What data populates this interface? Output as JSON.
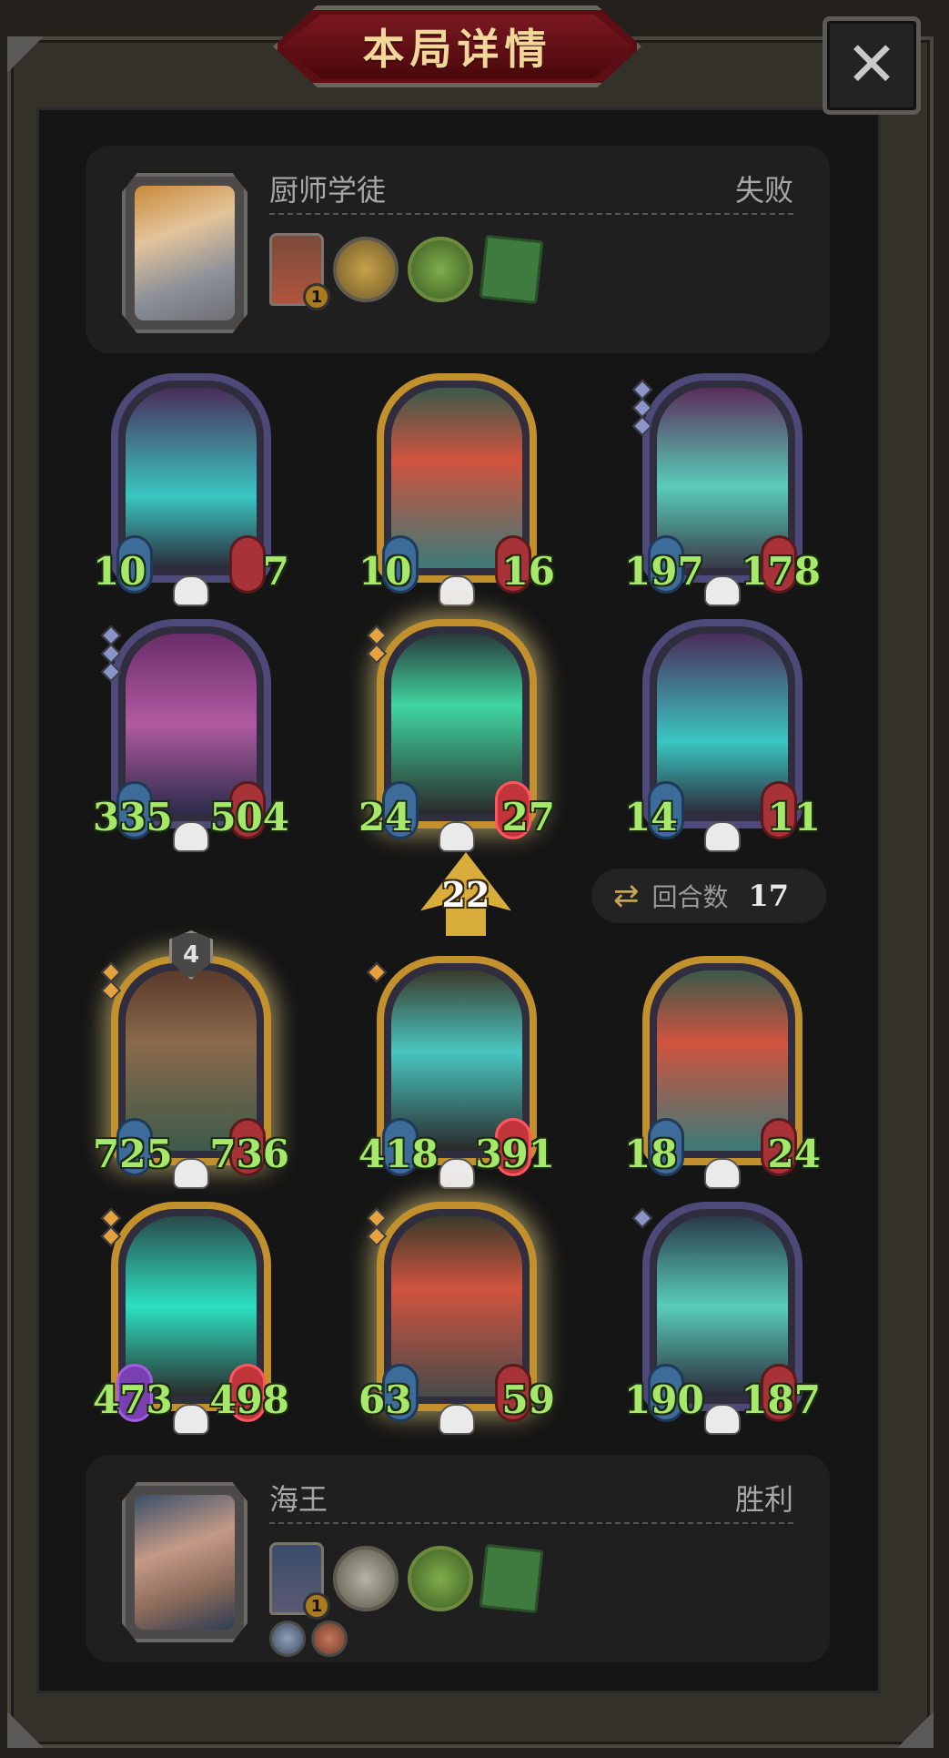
{
  "title": "本局详情",
  "close_icon": "close-icon",
  "player_top": {
    "name": "厨师学徒",
    "result": "失败",
    "hero_level": "1"
  },
  "player_bottom": {
    "name": "海王",
    "result": "胜利",
    "hero_level": "1"
  },
  "board_level": "22",
  "round": {
    "label": "回合数",
    "value": "17"
  },
  "units": [
    {
      "atk": "10",
      "hp": "7"
    },
    {
      "atk": "10",
      "hp": "16"
    },
    {
      "atk": "197",
      "hp": "178"
    },
    {
      "atk": "335",
      "hp": "504"
    },
    {
      "atk": "24",
      "hp": "27"
    },
    {
      "atk": "14",
      "hp": "11"
    },
    {
      "atk": "725",
      "hp": "736",
      "badge": "4"
    },
    {
      "atk": "418",
      "hp": "391"
    },
    {
      "atk": "18",
      "hp": "24"
    },
    {
      "atk": "473",
      "hp": "498"
    },
    {
      "atk": "63",
      "hp": "59"
    },
    {
      "atk": "190",
      "hp": "187"
    }
  ],
  "colors": {
    "stat_text": "#a6e86a",
    "title_text": "#f1d79a",
    "title_plate": "#5c0e14",
    "panel_bg": "#1f1f1f",
    "board_bg": "#151515"
  }
}
